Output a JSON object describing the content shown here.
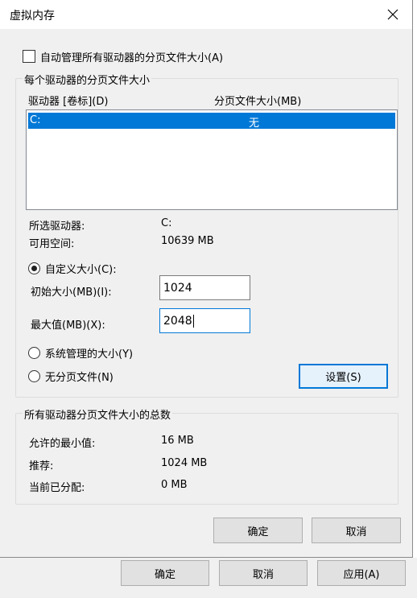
{
  "window": {
    "title": "虚拟内存"
  },
  "auto_manage": {
    "label": "自动管理所有驱动器的分页文件大小(A)",
    "checked": false
  },
  "per_drive": {
    "group_label": "每个驱动器的分页文件大小",
    "col_drive": "驱动器 [卷标](D)",
    "col_size": "分页文件大小(MB)",
    "rows": [
      {
        "drive": "C:",
        "size": "无",
        "selected": true
      }
    ],
    "selected_drive_label": "所选驱动器:",
    "selected_drive_value": "C:",
    "free_space_label": "可用空间:",
    "free_space_value": "10639 MB",
    "custom_size_label": "自定义大小(C):",
    "initial_size_label": "初始大小(MB)(I):",
    "initial_size_value": "1024",
    "max_size_label": "最大值(MB)(X):",
    "max_size_value": "2048",
    "system_managed_label": "系统管理的大小(Y)",
    "no_paging_label": "无分页文件(N)",
    "set_button": "设置(S)",
    "selected_option": "custom"
  },
  "totals": {
    "group_label": "所有驱动器分页文件大小的总数",
    "min_label": "允许的最小值:",
    "min_value": "16 MB",
    "recommended_label": "推荐:",
    "recommended_value": "1024 MB",
    "current_label": "当前已分配:",
    "current_value": "0 MB"
  },
  "buttons": {
    "ok": "确定",
    "cancel": "取消"
  },
  "parent_buttons": {
    "ok": "确定",
    "cancel": "取消",
    "apply": "应用(A)"
  },
  "colors": {
    "accent": "#0078d7",
    "dialog_bg": "#f0f0f0"
  }
}
